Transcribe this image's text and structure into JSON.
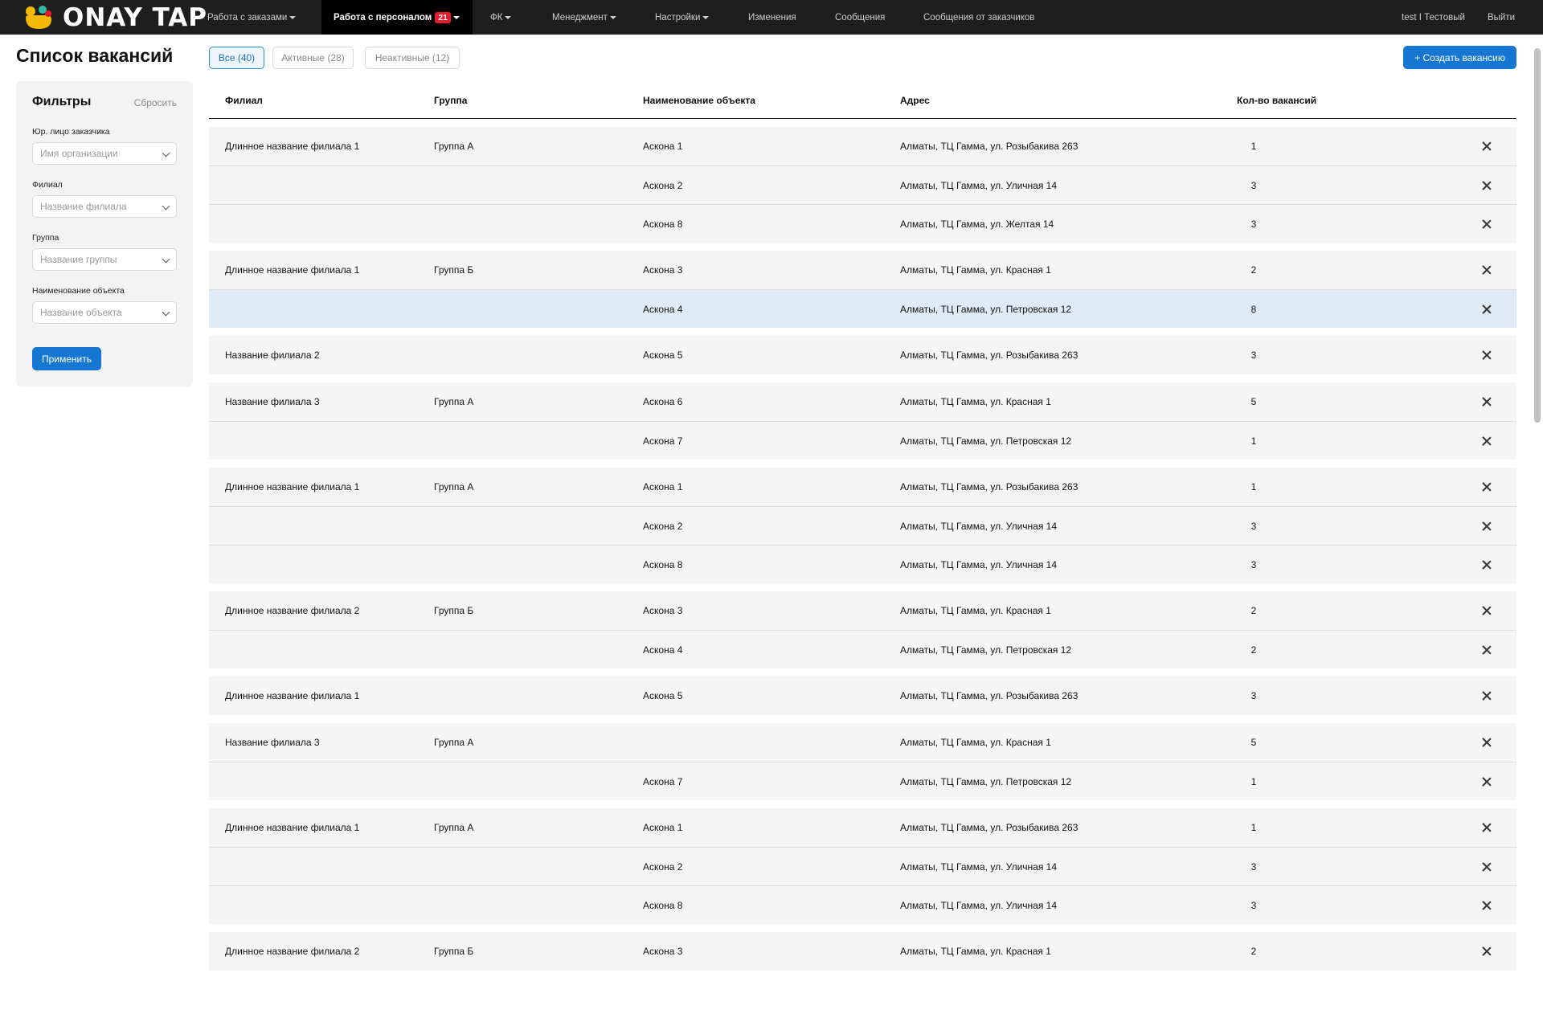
{
  "brand": {
    "name": "ONAY TAP",
    "logo_colors": [
      "#f5b800",
      "#2bbfa5",
      "#e8192c"
    ]
  },
  "nav": {
    "items": [
      {
        "label": "Работа с заказами",
        "dropdown": true
      },
      {
        "label": "Работа с персоналом",
        "dropdown": true,
        "active": true,
        "badge": "21"
      },
      {
        "label": "ФК",
        "dropdown": true
      },
      {
        "label": "Менеджмент",
        "dropdown": true
      },
      {
        "label": "Настройки",
        "dropdown": true
      },
      {
        "label": "Изменения",
        "dropdown": false
      },
      {
        "label": "Сообщения",
        "dropdown": false
      },
      {
        "label": "Сообщения от заказчиков",
        "dropdown": false
      }
    ],
    "user": "test I Тестовый",
    "logout": "Выйти"
  },
  "page": {
    "title": "Список вакансий",
    "tabs": [
      {
        "label": "Все (40)",
        "active": true
      },
      {
        "label": "Активные (28)",
        "active": false
      },
      {
        "label": "Неактивные (12)",
        "active": false
      }
    ],
    "create_button": "+ Создать вакансию"
  },
  "filters": {
    "title": "Фильтры",
    "reset": "Сбросить",
    "fields": [
      {
        "label": "Юр. лицо заказчика",
        "placeholder": "Имя организации"
      },
      {
        "label": "Филиал",
        "placeholder": "Название филиала"
      },
      {
        "label": "Группа",
        "placeholder": "Название группы"
      },
      {
        "label": "Наименование объекта",
        "placeholder": "Название объекта"
      }
    ],
    "apply": "Применить"
  },
  "table": {
    "columns": [
      "Филиал",
      "Группа",
      "Наименование объекта",
      "Адрес",
      "Кол-во вакансий"
    ],
    "groups": [
      {
        "rows": [
          {
            "branch": "Длинное название филиала 1",
            "group": "Группа А",
            "object": "Аскона 1",
            "address": "Алматы, ТЦ Гамма, ул. Розыбакива 263",
            "count": "1"
          },
          {
            "branch": "",
            "group": "",
            "object": "Аскона 2",
            "address": "Алматы, ТЦ Гамма, ул. Уличная 14",
            "count": "3"
          },
          {
            "branch": "",
            "group": "",
            "object": "Аскона 8",
            "address": "Алматы, ТЦ Гамма, ул. Желтая 14",
            "count": "3"
          }
        ]
      },
      {
        "rows": [
          {
            "branch": "Длинное название филиала 1",
            "group": "Группа Б",
            "object": "Аскона 3",
            "address": "Алматы, ТЦ Гамма, ул. Красная 1",
            "count": "2"
          },
          {
            "branch": "",
            "group": "",
            "object": "Аскона 4",
            "address": "Алматы, ТЦ Гамма, ул. Петровская 12",
            "count": "8",
            "highlighted": true
          }
        ]
      },
      {
        "rows": [
          {
            "branch": "Название филиала 2",
            "group": "",
            "object": "Аскона 5",
            "address": "Алматы, ТЦ Гамма, ул. Розыбакива 263",
            "count": "3"
          }
        ]
      },
      {
        "rows": [
          {
            "branch": "Название филиала 3",
            "group": "Группа А",
            "object": "Аскона 6",
            "address": "Алматы, ТЦ Гамма, ул. Красная 1",
            "count": "5"
          },
          {
            "branch": "",
            "group": "",
            "object": "Аскона 7",
            "address": "Алматы, ТЦ Гамма, ул. Петровская 12",
            "count": "1"
          }
        ]
      },
      {
        "rows": [
          {
            "branch": "Длинное название филиала 1",
            "group": "Группа А",
            "object": "Аскона 1",
            "address": "Алматы, ТЦ Гамма, ул. Розыбакива 263",
            "count": "1"
          },
          {
            "branch": "",
            "group": "",
            "object": "Аскона 2",
            "address": "Алматы, ТЦ Гамма, ул. Уличная 14",
            "count": "3"
          },
          {
            "branch": "",
            "group": "",
            "object": "Аскона 8",
            "address": "Алматы, ТЦ Гамма, ул. Уличная 14",
            "count": "3"
          }
        ]
      },
      {
        "rows": [
          {
            "branch": "Длинное название филиала 2",
            "group": "Группа Б",
            "object": "Аскона 3",
            "address": "Алматы, ТЦ Гамма, ул. Красная 1",
            "count": "2"
          },
          {
            "branch": "",
            "group": "",
            "object": "Аскона 4",
            "address": "Алматы, ТЦ Гамма, ул. Петровская 12",
            "count": "2"
          }
        ]
      },
      {
        "rows": [
          {
            "branch": "Длинное название филиала 1",
            "group": "",
            "object": "Аскона 5",
            "address": "Алматы, ТЦ Гамма, ул. Розыбакива 263",
            "count": "3"
          }
        ]
      },
      {
        "rows": [
          {
            "branch": "Название филиала 3",
            "group": "Группа А",
            "object": "",
            "address": "Алматы, ТЦ Гамма, ул. Красная 1",
            "count": "5"
          },
          {
            "branch": "",
            "group": "",
            "object": "Аскона 7",
            "address": "Алматы, ТЦ Гамма, ул. Петровская 12",
            "count": "1"
          }
        ]
      },
      {
        "rows": [
          {
            "branch": "Длинное название филиала 1",
            "group": "Группа А",
            "object": "Аскона 1",
            "address": "Алматы, ТЦ Гамма, ул. Розыбакива 263",
            "count": "1"
          },
          {
            "branch": "",
            "group": "",
            "object": "Аскона 2",
            "address": "Алматы, ТЦ Гамма, ул. Уличная 14",
            "count": "3"
          },
          {
            "branch": "",
            "group": "",
            "object": "Аскона 8",
            "address": "Алматы, ТЦ Гамма, ул. Уличная 14",
            "count": "3"
          }
        ]
      },
      {
        "rows": [
          {
            "branch": "Длинное название филиала 2",
            "group": "Группа Б",
            "object": "Аскона 3",
            "address": "Алматы, ТЦ Гамма, ул. Красная 1",
            "count": "2"
          }
        ]
      }
    ]
  }
}
